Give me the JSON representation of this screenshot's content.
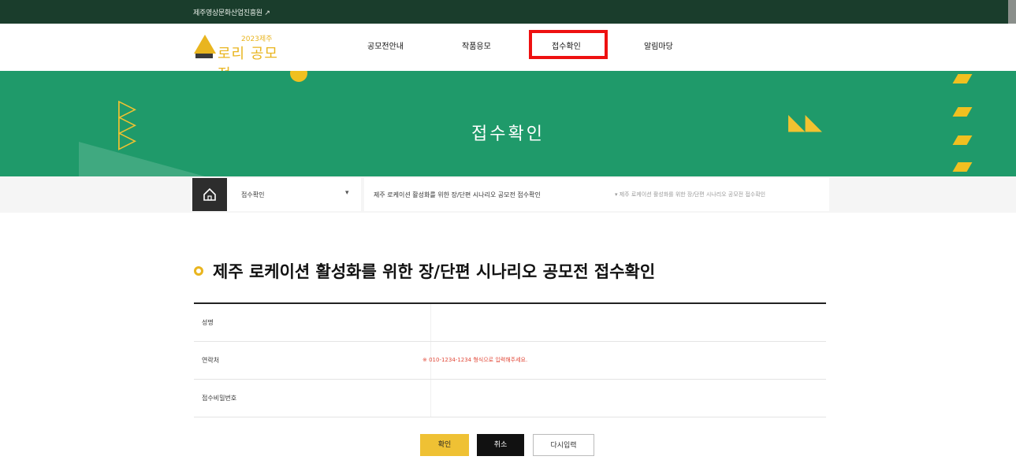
{
  "topbar": {
    "org_name": "제주영상문화산업진흥원 ↗"
  },
  "logo": {
    "year": "2023제주",
    "name": "로리 공모전"
  },
  "nav": {
    "items": [
      {
        "label": "공모전안내"
      },
      {
        "label": "작품응모"
      },
      {
        "label": "접수확인"
      },
      {
        "label": "알림마당"
      }
    ],
    "active": "접수확인"
  },
  "banner": {
    "title": "접수확인"
  },
  "breadcrumb": {
    "level1": "접수확인",
    "level2": "제주 로케이션 활성화를 위한 장/단편 시나리오 공모전 접수확인",
    "level2_extra": "▾ 제주 로케이션 활성화를 위한 장/단편 시나리오 공모전 접수확인"
  },
  "page": {
    "title": "제주 로케이션 활성화를 위한 장/단편 시나리오 공모전 접수확인"
  },
  "form": {
    "rows": [
      {
        "label": "성명",
        "hint": ""
      },
      {
        "label": "연락처",
        "hint": "※ 010-1234-1234 형식으로 입력해주세요."
      },
      {
        "label": "접수비밀번호",
        "hint": ""
      }
    ]
  },
  "buttons": {
    "confirm": "확인",
    "cancel": "취소",
    "reset": "다시입력"
  },
  "colors": {
    "topbar": "#1a3d2c",
    "banner": "#1f9a6a",
    "accent": "#e9b51f",
    "highlight": "#ee1111"
  }
}
